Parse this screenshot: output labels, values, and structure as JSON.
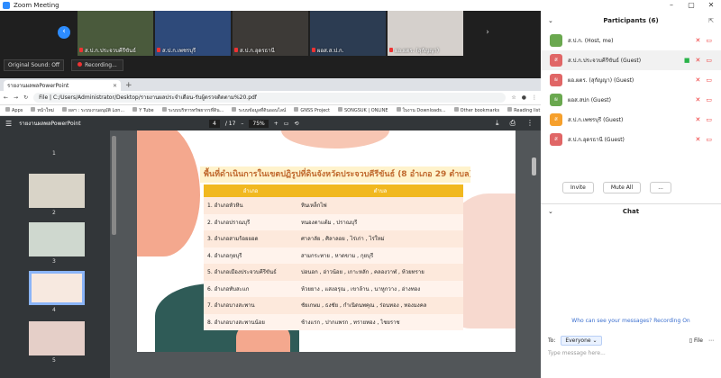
{
  "window": {
    "title": "Zoom Meeting"
  },
  "gallery": {
    "participants": [
      {
        "name": "ส.ป.ก.ประจวบคีรีขันธ์",
        "bg": "#4a5a3c"
      },
      {
        "name": "ส.ป.ก.เพชรบุรี",
        "bg": "#2e4a7a"
      },
      {
        "name": "ส.ป.ก.อุดรธานี",
        "bg": "#3d3a37"
      },
      {
        "name": "ผอส.ส.ป.ก.",
        "bg": "#2c3c52"
      },
      {
        "name": "ผอ.ผตร. (สุกัญญา)",
        "bg": "#d5d0cc"
      }
    ]
  },
  "audio": {
    "original_sound": "Original Sound: Off",
    "recording": "Recording..."
  },
  "browser": {
    "tab_title": "รายงานผลพลPowerPoint",
    "address_scheme": "File",
    "address": "C:/Users/Administrator/Desktop/รายงานผลประจำเดือน-รับผู้ตรวจติดตาม%20.pdf",
    "bookmarks": [
      "Apps",
      "หน้าใหม่",
      "ผลฯ : ระบบงานอนุมัติ Lon...",
      "Y Tube",
      "ระบบบริหารทรัพยากรที่ดิน...",
      "ระบบข้อมูลที่ดินออนไลน์",
      "GNSS Project",
      "SONGSUK | ONLINE",
      "ใบงาน Downloads..."
    ],
    "other_bookmarks": "Other bookmarks",
    "reading_list": "Reading list"
  },
  "pdf": {
    "doc_title": "รายงานผลพลPowerPoint",
    "page_current": "4",
    "page_total": "/ 17",
    "zoom": "75%",
    "thumb_numbers": [
      "1",
      "2",
      "3",
      "4",
      "5"
    ]
  },
  "slide": {
    "title": "พื้นที่ดำเนินการในเขตปฏิรูปที่ดินจังหวัดประจวบคีรีขันธ์ (8 อำเภอ 29 ตำบล)",
    "col_district": "อำเภอ",
    "col_subdistrict": "ตำบล",
    "rows": [
      {
        "d": "1. อำเภอหัวหิน",
        "s": "หินเหล็กไฟ"
      },
      {
        "d": "2. อำเภอปราณบุรี",
        "s": "หนองตาแต้ม , ปราณบุรี"
      },
      {
        "d": "3. อำเภอสามร้อยยอด",
        "s": "ศาลาลัย , ศิลาลอย , ไร่เก่า , ไร่ใหม่"
      },
      {
        "d": "4. อำเภอกุยบุรี",
        "s": "สามกระทาย , หาดขาม , กุยบุรี"
      },
      {
        "d": "5. อำเภอเมืองประจวบคีรีขันธ์",
        "s": "บ่อนอก , อ่าวน้อย , เกาะหลัก , คลองวาฬ , ห้วยทราย"
      },
      {
        "d": "6. อำเภอทับสะแก",
        "s": "ห้วยยาง , แสงอรุณ , เขาล้าน , นาหูกวาง , อ่างทอง"
      },
      {
        "d": "7. อำเภอบางสะพาน",
        "s": "ชัยเกษม , ธงชัย , กำเนิดนพคุณ , ร่อนทอง , ทองมงคล"
      },
      {
        "d": "8. อำเภอบางสะพานน้อย",
        "s": "ช้างแรก , ปากแพรก , ทรายทอง , ไชยราช"
      }
    ]
  },
  "panel": {
    "participants_title": "Participants (6)",
    "people": [
      {
        "name": "ส.ป.ก. (Host, me)",
        "initials": "",
        "color": "#6aa84f"
      },
      {
        "name": "ส.ป.ก.ประจวบคีรีขันธ์ (Guest)",
        "initials": "ส",
        "color": "#e06666"
      },
      {
        "name": "ผอ.ผตร. (สุกัญญา) (Guest)",
        "initials": "ผ",
        "color": "#e06666"
      },
      {
        "name": "ผอส.สปก (Guest)",
        "initials": "ผ",
        "color": "#6aa84f"
      },
      {
        "name": "ส.ป.ก.เพชรบุรี (Guest)",
        "initials": "ส",
        "color": "#f6a02c"
      },
      {
        "name": "ส.ป.ก.อุดรธานี (Guest)",
        "initials": "ส",
        "color": "#e06666"
      }
    ],
    "invite": "Invite",
    "mute_all": "Mute All",
    "more": "...",
    "chat_title": "Chat",
    "who_can_see": "Who can see your messages? Recording On",
    "to_label": "To:",
    "to_value": "Everyone",
    "file_label": "File",
    "message_placeholder": "Type message here..."
  }
}
